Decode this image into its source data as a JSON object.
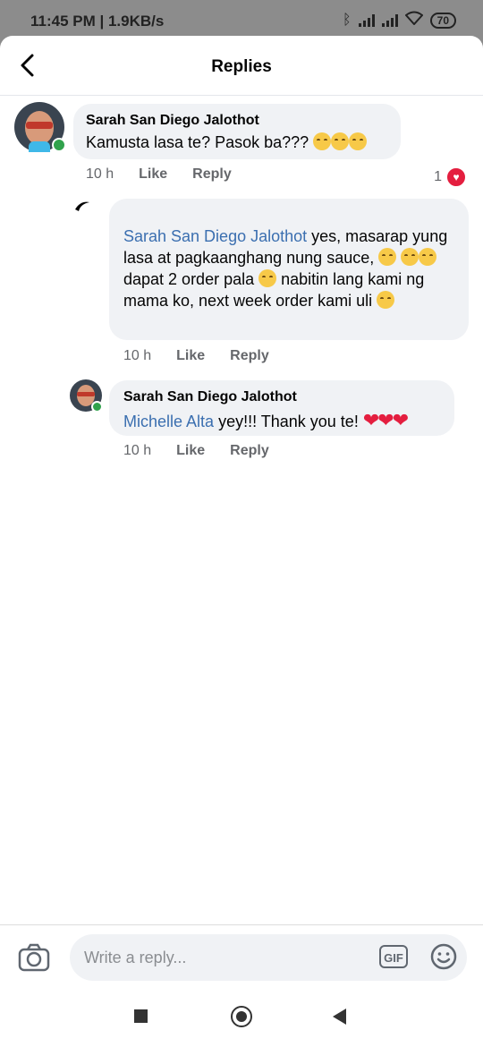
{
  "status_bar": {
    "time": "11:45 PM | 1.9KB/s",
    "battery": "70"
  },
  "header": {
    "title": "Replies",
    "back_icon": "chevron-left-icon"
  },
  "comments": [
    {
      "author": "Sarah San Diego Jalothot",
      "text": "Kamusta lasa te? Pasok ba???",
      "emojis": "😊😊😊",
      "time": "10 h",
      "like_label": "Like",
      "reply_label": "Reply",
      "reaction_count": "1",
      "online": true
    },
    {
      "mention": "Sarah San Diego Jalothot",
      "text_parts": [
        " yes, masarap yung lasa at pagkaanghang nung sauce, ",
        " dapat 2 order pala ",
        " nabitin lang kami ng mama ko, next week order kami uli "
      ],
      "time": "10 h",
      "like_label": "Like",
      "reply_label": "Reply"
    },
    {
      "author": "Sarah San Diego Jalothot",
      "mention": "Michelle Alta",
      "text": " yey!!! Thank you te! ",
      "hearts": "❤❤❤",
      "time": "10 h",
      "like_label": "Like",
      "reply_label": "Reply",
      "online": true
    }
  ],
  "composer": {
    "placeholder": "Write a reply...",
    "gif_label": "GIF"
  },
  "colors": {
    "mention": "#3b6fb0",
    "online": "#31a24c",
    "love": "#e41e3f",
    "bubble": "#f0f2f5"
  }
}
